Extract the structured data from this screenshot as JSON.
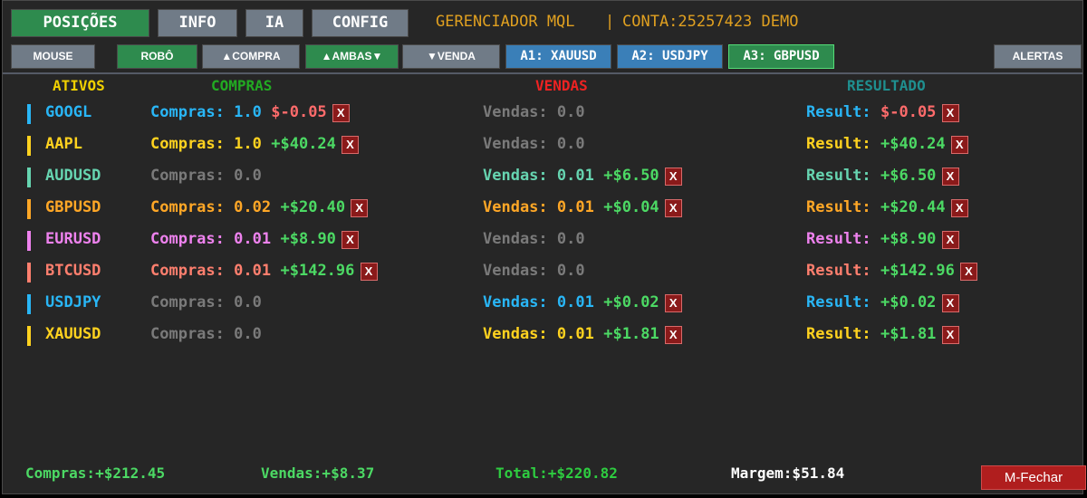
{
  "tabs": {
    "positions": "POSIÇÕES",
    "info": "INFO",
    "ia": "IA",
    "config": "CONFIG"
  },
  "header": {
    "title": "GERENCIADOR MQL",
    "separator": "|",
    "account": "CONTA:25257423 DEMO"
  },
  "toolbar": {
    "mouse": "MOUSE",
    "robot": "ROBÔ",
    "buy": "▲COMPRA",
    "both": "▲AMBAS▼",
    "sell": "▼VENDA",
    "a1": "A1: XAUUSD",
    "a2": "A2: USDJPY",
    "a3": "A3: GBPUSD",
    "alerts": "ALERTAS"
  },
  "columns": {
    "assets": "ATIVOS",
    "buys": "COMPRAS",
    "sells": "VENDAS",
    "result": "RESULTADO"
  },
  "colors": {
    "assets_header": "#f0d000",
    "buys_header": "#22aa22",
    "sells_header": "#ee2222",
    "result_header": "#1f8f8f",
    "positive": "#4cd964",
    "negative": "#ff6b6b",
    "muted": "#7a7a7a"
  },
  "rows": [
    {
      "symbol": "GOOGL",
      "color": "#29b6f6",
      "buy_label": "Compras: 1.0",
      "buy_pl": "$-0.05",
      "buy_pl_sign": "neg",
      "buy_x": "X",
      "sell_label": "Vendas: 0.0",
      "sell_pl": "",
      "sell_x": "",
      "result_label": "Result:",
      "result_pl": "$-0.05",
      "result_sign": "neg",
      "result_x": "X"
    },
    {
      "symbol": "AAPL",
      "color": "#ffd21f",
      "buy_label": "Compras: 1.0",
      "buy_pl": "+$40.24",
      "buy_pl_sign": "pos",
      "buy_x": "X",
      "sell_label": "Vendas: 0.0",
      "sell_pl": "",
      "sell_x": "",
      "result_label": "Result:",
      "result_pl": "+$40.24",
      "result_sign": "pos",
      "result_x": "X"
    },
    {
      "symbol": "AUDUSD",
      "color": "#66d4b0",
      "buy_label": "Compras: 0.0",
      "buy_pl": "",
      "buy_pl_sign": "",
      "buy_x": "",
      "sell_label": "Vendas: 0.01",
      "sell_pl": "+$6.50",
      "sell_x": "X",
      "result_label": "Result:",
      "result_pl": "+$6.50",
      "result_sign": "pos",
      "result_x": "X"
    },
    {
      "symbol": "GBPUSD",
      "color": "#ffa726",
      "buy_label": "Compras: 0.02",
      "buy_pl": "+$20.40",
      "buy_pl_sign": "pos",
      "buy_x": "X",
      "sell_label": "Vendas: 0.01",
      "sell_pl": "+$0.04",
      "sell_x": "X",
      "result_label": "Result:",
      "result_pl": "+$20.44",
      "result_sign": "pos",
      "result_x": "X"
    },
    {
      "symbol": "EURUSD",
      "color": "#ee82ee",
      "buy_label": "Compras: 0.01",
      "buy_pl": "+$8.90",
      "buy_pl_sign": "pos",
      "buy_x": "X",
      "sell_label": "Vendas: 0.0",
      "sell_pl": "",
      "sell_x": "",
      "result_label": "Result:",
      "result_pl": "+$8.90",
      "result_sign": "pos",
      "result_x": "X"
    },
    {
      "symbol": "BTCUSD",
      "color": "#ff7f6e",
      "buy_label": "Compras: 0.01",
      "buy_pl": "+$142.96",
      "buy_pl_sign": "pos",
      "buy_x": "X",
      "sell_label": "Vendas: 0.0",
      "sell_pl": "",
      "sell_x": "",
      "result_label": "Result:",
      "result_pl": "+$142.96",
      "result_sign": "pos",
      "result_x": "X"
    },
    {
      "symbol": "USDJPY",
      "color": "#29b6f6",
      "buy_label": "Compras: 0.0",
      "buy_pl": "",
      "buy_pl_sign": "",
      "buy_x": "",
      "sell_label": "Vendas: 0.01",
      "sell_pl": "+$0.02",
      "sell_x": "X",
      "result_label": "Result:",
      "result_pl": "+$0.02",
      "result_sign": "pos",
      "result_x": "X"
    },
    {
      "symbol": "XAUUSD",
      "color": "#ffd21f",
      "buy_label": "Compras: 0.0",
      "buy_pl": "",
      "buy_pl_sign": "",
      "buy_x": "",
      "sell_label": "Vendas: 0.01",
      "sell_pl": "+$1.81",
      "sell_x": "X",
      "result_label": "Result:",
      "result_pl": "+$1.81",
      "result_sign": "pos",
      "result_x": "X"
    }
  ],
  "footer": {
    "buys_total": "Compras:+$212.45",
    "sells_total": "Vendas:+$8.37",
    "total": "Total:+$220.82",
    "margin": "Margem:$51.84",
    "close_button": "M-Fechar"
  }
}
